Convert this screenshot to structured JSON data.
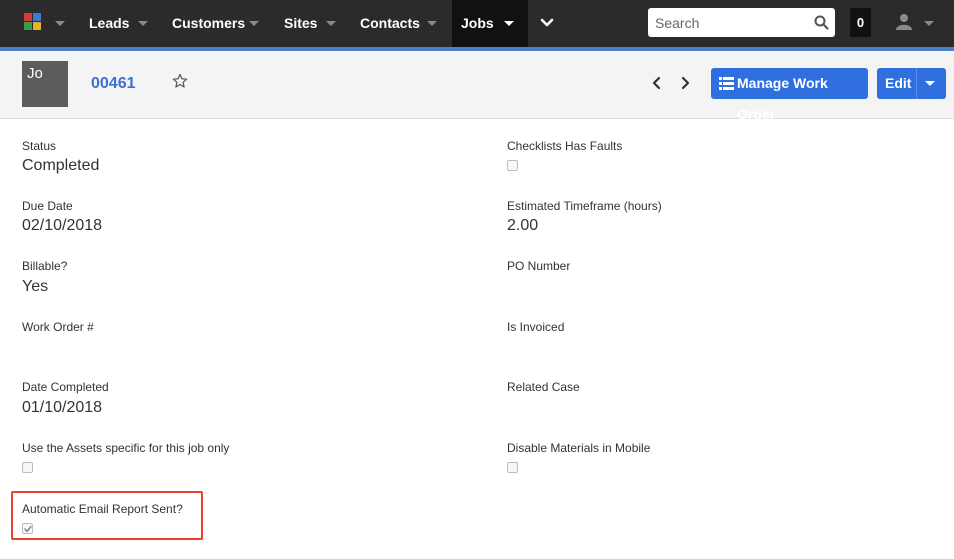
{
  "nav": {
    "items": [
      {
        "label": "Leads"
      },
      {
        "label": "Customers"
      },
      {
        "label": "Sites"
      },
      {
        "label": "Contacts"
      },
      {
        "label": "Jobs"
      }
    ],
    "search_placeholder": "Search",
    "notification_count": "0",
    "accent_color": "#4a7fc4",
    "bar_color": "#2b2b2b"
  },
  "header": {
    "avatar_initials": "Jo",
    "record_id": "00461",
    "manage_button_label": "Manage Work Order",
    "edit_button_label": "Edit"
  },
  "fields": {
    "left": [
      {
        "label": "Status",
        "value": "Completed"
      },
      {
        "label": "Due Date",
        "value": "02/10/2018"
      },
      {
        "label": "Billable?",
        "value": "Yes"
      },
      {
        "label": "Work Order #",
        "value": ""
      },
      {
        "label": "Date Completed",
        "value": "01/10/2018"
      },
      {
        "label": "Use the Assets specific for this job only",
        "checked": false
      },
      {
        "label": "Automatic Email Report Sent?",
        "checked": true
      }
    ],
    "right": [
      {
        "label": "Checklists Has Faults",
        "checked": false
      },
      {
        "label": "Estimated Timeframe (hours)",
        "value": "2.00"
      },
      {
        "label": "PO Number",
        "value": ""
      },
      {
        "label": "Is Invoiced",
        "value": ""
      },
      {
        "label": "Related Case",
        "value": ""
      },
      {
        "label": "Disable Materials in Mobile",
        "checked": false
      }
    ]
  }
}
